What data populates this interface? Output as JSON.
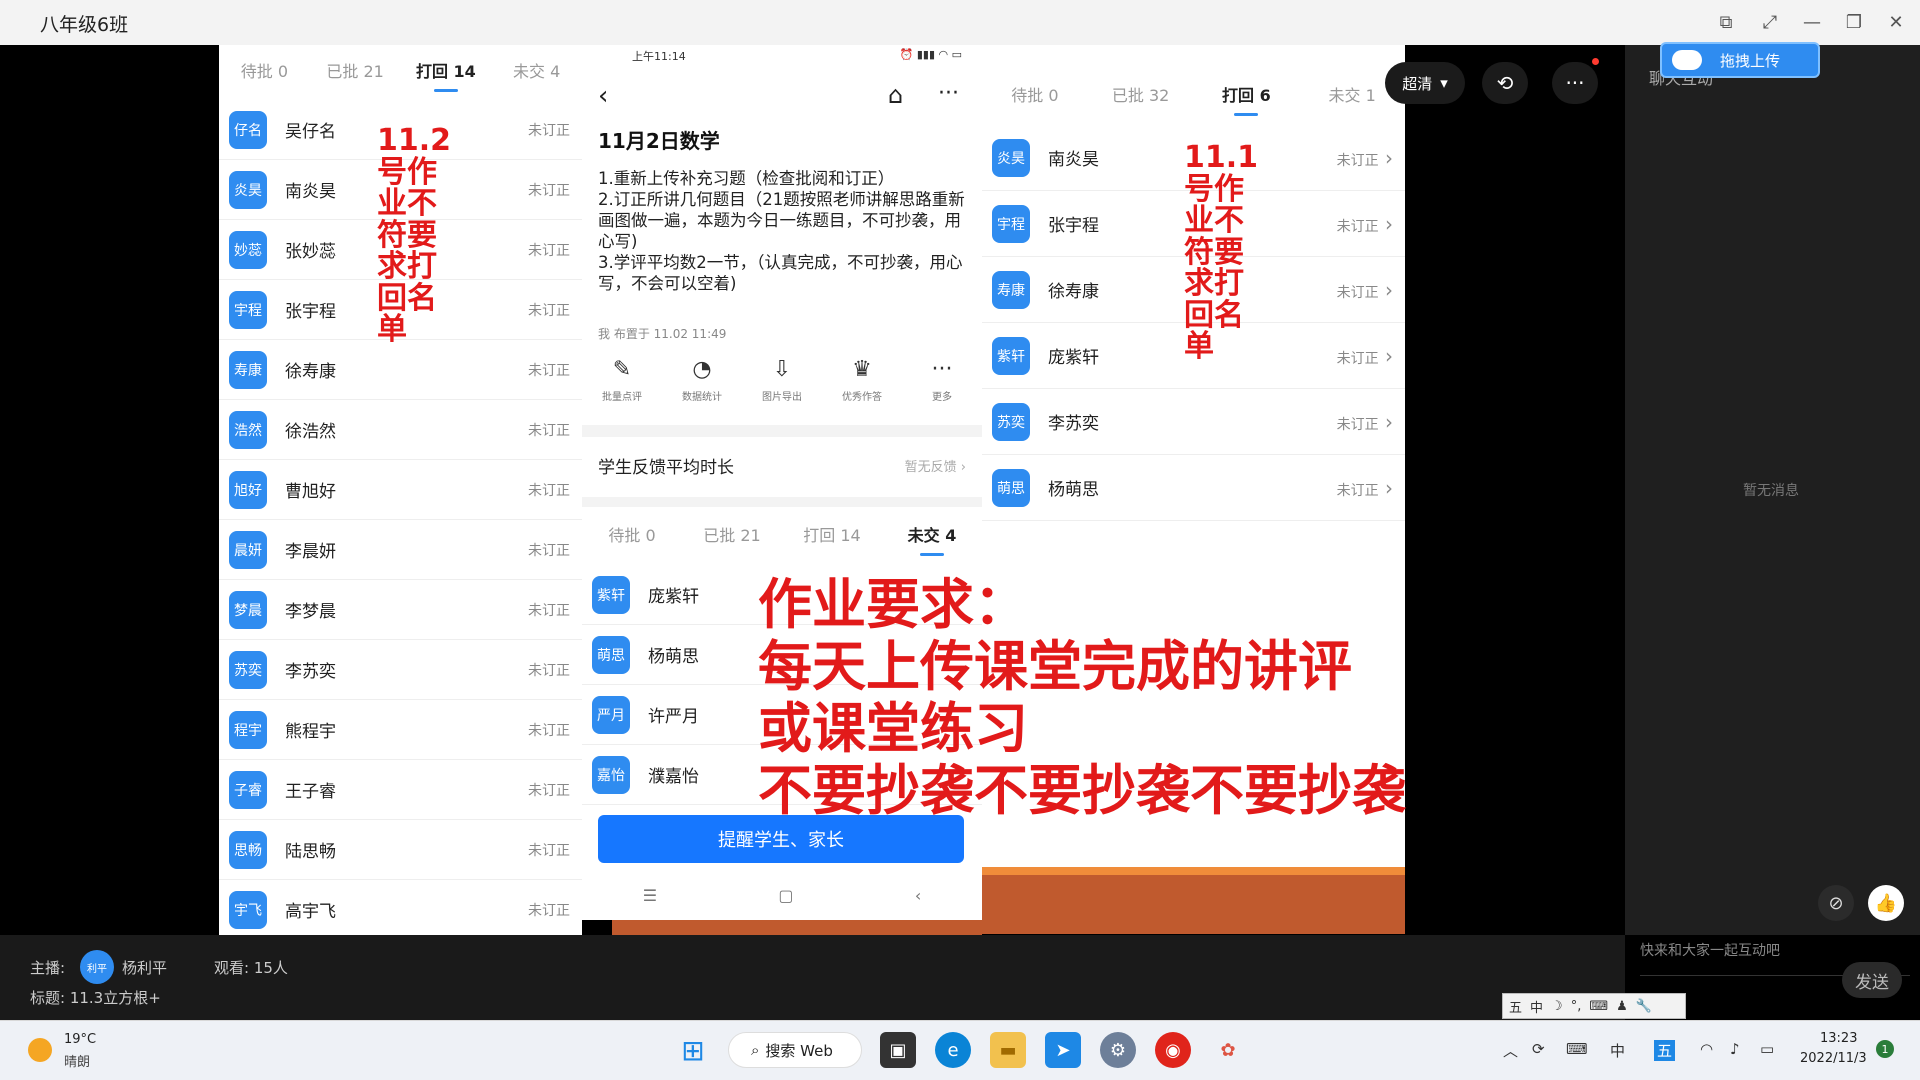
{
  "window": {
    "title": "八年级6班"
  },
  "player": {
    "quality": "超清",
    "upload_label": "拖拽上传"
  },
  "left_list": {
    "tabs": [
      "待批 0",
      "已批 21",
      "打回 14",
      "未交 4"
    ],
    "active_tab": 2,
    "status": "未订正",
    "students": [
      {
        "badge": "仔名",
        "name": "吴仔名"
      },
      {
        "badge": "炎昊",
        "name": "南炎昊"
      },
      {
        "badge": "妙蕊",
        "name": "张妙蕊"
      },
      {
        "badge": "宇程",
        "name": "张宇程"
      },
      {
        "badge": "寿康",
        "name": "徐寿康"
      },
      {
        "badge": "浩然",
        "name": "徐浩然"
      },
      {
        "badge": "旭好",
        "name": "曹旭好"
      },
      {
        "badge": "晨妍",
        "name": "李晨妍"
      },
      {
        "badge": "梦晨",
        "name": "李梦晨"
      },
      {
        "badge": "苏奕",
        "name": "李苏奕"
      },
      {
        "badge": "程宇",
        "name": "熊程宇"
      },
      {
        "badge": "子睿",
        "name": "王子睿"
      },
      {
        "badge": "思畅",
        "name": "陆思畅"
      },
      {
        "badge": "宇飞",
        "name": "高宇飞"
      }
    ],
    "note": [
      "11.2",
      "号作",
      "业不",
      "符要",
      "求打",
      "回名",
      "单"
    ]
  },
  "mid_detail": {
    "status_time": "上午11:14",
    "title": "11月2日数学",
    "body": [
      "1.重新上传补充习题（检查批阅和订正）",
      "2.订正所讲几何题目（21题按照老师讲解思路重新画图做一遍，本题为今日一练题目，不可抄袭，用心写)",
      "3.学评平均数2一节，（认真完成，不可抄袭，用心写，不会可以空着)"
    ],
    "meta": "我 布置于 11.02 11:49",
    "tools": [
      {
        "glyph": "✎",
        "label": "批量点评"
      },
      {
        "glyph": "◔",
        "label": "数据统计"
      },
      {
        "glyph": "⇩",
        "label": "图片导出"
      },
      {
        "glyph": "♛",
        "label": "优秀作答"
      },
      {
        "glyph": "···",
        "label": "更多"
      }
    ],
    "feedback_label": "学生反馈平均时长",
    "feedback_value": "暂无反馈",
    "tabs": [
      "待批 0",
      "已批 21",
      "打回 14",
      "未交 4"
    ],
    "active_tab": 3,
    "missing": [
      {
        "badge": "紫轩",
        "name": "庞紫轩"
      },
      {
        "badge": "萌思",
        "name": "杨萌思"
      },
      {
        "badge": "严月",
        "name": "许严月"
      },
      {
        "badge": "嘉怡",
        "name": "濮嘉怡"
      }
    ],
    "remind_button": "提醒学生、家长",
    "navbar": [
      "☰",
      "▢",
      "‹"
    ]
  },
  "right_list": {
    "tabs": [
      "待批 0",
      "已批 32",
      "打回 6",
      "未交 1"
    ],
    "active_tab": 2,
    "status": "未订正",
    "students": [
      {
        "badge": "炎昊",
        "name": "南炎昊"
      },
      {
        "badge": "宇程",
        "name": "张宇程"
      },
      {
        "badge": "寿康",
        "name": "徐寿康"
      },
      {
        "badge": "紫轩",
        "name": "庞紫轩"
      },
      {
        "badge": "苏奕",
        "name": "李苏奕"
      },
      {
        "badge": "萌思",
        "name": "杨萌思"
      }
    ],
    "note": [
      "11.1",
      "号作",
      "业不",
      "符要",
      "求打",
      "回名",
      "单"
    ]
  },
  "requirement": {
    "line1": "作业要求：",
    "line2": "每天上传课堂完成的讲评",
    "line3": "或课堂练习",
    "line4": "不要抄袭不要抄袭不要抄袭"
  },
  "chat": {
    "header": "聊天互动",
    "empty": "暂无消息",
    "input_placeholder": "快来和大家一起互动吧",
    "send": "发送"
  },
  "info": {
    "host_label": "主播:",
    "host_avatar": "利平",
    "host_name": "杨利平",
    "viewers": "观看: 15人",
    "topic": "标题: 11.3立方根+"
  },
  "ime": [
    "五",
    "中",
    "☽",
    "°,",
    "⌨",
    "♟",
    "🔧"
  ],
  "taskbar": {
    "weather_temp": "19°C",
    "weather_desc": "晴朗",
    "search": "搜索 Web",
    "time": "13:23",
    "date": "2022/11/3",
    "notif_count": "1",
    "ime_tray": "五"
  },
  "colors": {
    "accent": "#2f8cf0",
    "note_red": "#e21a1a",
    "button_blue": "#1677ff"
  }
}
